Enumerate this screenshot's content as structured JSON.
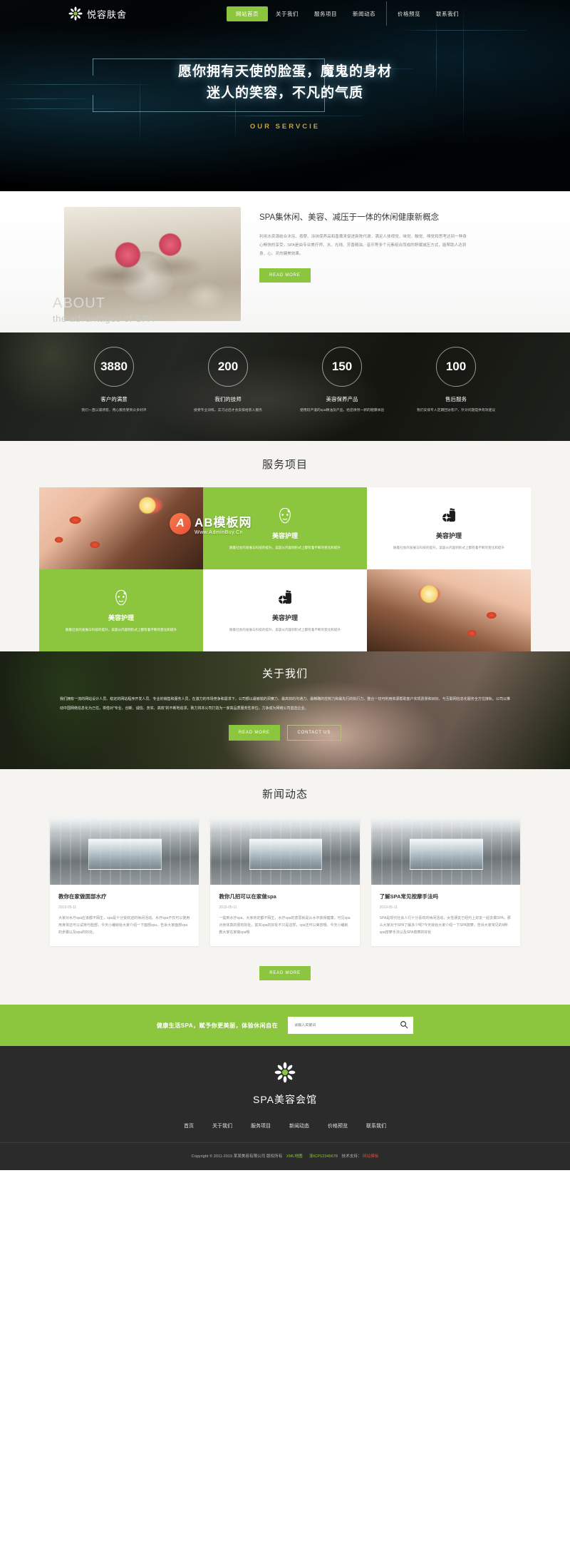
{
  "header": {
    "brand": "悦容肤舍",
    "logo_icon": "flower-icon",
    "nav": [
      {
        "label": "网站首页",
        "active": true
      },
      {
        "label": "关于我们",
        "active": false
      },
      {
        "label": "服务项目",
        "active": false
      },
      {
        "label": "新闻动态",
        "active": false
      },
      {
        "label": "价格预览",
        "active": false
      },
      {
        "label": "联系我们",
        "active": false
      }
    ]
  },
  "hero": {
    "line1": "愿你拥有天使的脸蛋，魔鬼的身材",
    "line2": "迷人的笑容，不凡的气质",
    "subtitle": "OUR SERVCIE"
  },
  "about": {
    "heading": "SPA集休闲、美容、减压于一体的休闲健康新概念",
    "paragraph": "利用水资源结合沐浴、按摩、涂抹保养品和香薰来促进新陈代谢，满足人体视觉、味觉、触觉、嗅觉和思考达到一种身心畅快的享受。SPA是由专业美疗师、水、光线、芳香精油、音乐等多个元素组合而成的舒缓减压方式，能帮助人达到身、心、灵的健美效果。",
    "button": "READ MORE",
    "watermark_big": "ABOUT",
    "watermark_small": "the advantages of SPA"
  },
  "stats": [
    {
      "number": "3880",
      "label": "客户的满意",
      "desc": "我们一直以诚待客，用心服务受到众多好评"
    },
    {
      "number": "200",
      "label": "我们的技师",
      "desc": "接受专业训练，实习过后才会安排给客人服务"
    },
    {
      "number": "150",
      "label": "美容保养产品",
      "desc": "使用较严谨的spa精油及产品，给您焕然一新的健康体验"
    },
    {
      "number": "100",
      "label": "售后服务",
      "desc": "我们安排专人定期回访客户，针对问题提供有效建议"
    }
  ],
  "services": {
    "title": "服务项目",
    "watermark": {
      "badge": "A",
      "main": "AB模板网",
      "sub": "Www.AdminBuy.Cn"
    },
    "cards": [
      {
        "type": "image",
        "style": "hand",
        "icon": ""
      },
      {
        "type": "green",
        "icon": "facial-mask-icon",
        "title": "美容护理",
        "desc": "随着社会的发展与科技的提升，美容从内容到形式上都有着不断的变化和提升"
      },
      {
        "type": "white",
        "icon": "lotion-bottle-icon",
        "title": "美容护理",
        "desc": "随着社会的发展与科技的提升，美容从内容到形式上都有着不断的变化和提升"
      },
      {
        "type": "green",
        "icon": "facial-mask-icon",
        "title": "美容护理",
        "desc": "随着社会的发展与科技的提升，美容从内容到形式上都有着不断的变化和提升"
      },
      {
        "type": "white",
        "icon": "lotion-bottle-icon",
        "title": "美容护理",
        "desc": "随着社会的发展与科技的提升，美容从内容到形式上都有着不断的变化和提升"
      },
      {
        "type": "image",
        "style": "flower",
        "icon": ""
      }
    ]
  },
  "aboutus": {
    "title": "关于我们",
    "paragraph": "我们拥有一流的网站设计人员、稳定的网站程序开发人员、专业的销售和服务人员，在激力的市场竞争和需求下，公司额以最敏锐的洞察力、最高效的沟通力、最精确的控制力和最先行的执行力、整合一切可利用资源帮助客户实现愿景和目标、与互联网信息化服务全方位接轨。公司以推动中国网络信息化为己任，将借对\"专业、创新、诚信、务实、高效\"的不断地追求，致力将本公司打造为一家高品质服务性单位，力争成为网络公司首选企业。",
    "btn_primary": "READ MORE",
    "btn_secondary": "CONTACT US"
  },
  "news": {
    "title": "新闻动态",
    "more_button": "READ MORE",
    "cards": [
      {
        "title": "教你在家做面部水疗",
        "date": "2019-05-11",
        "desc": "大家对水疗spa应该都不陌生，spa是十分受欢迎的休闲活动。水疗spa不仅可以使用用身体还可以试用与脸部，今天小编就给大家介绍一下面部spa，告诉大家面部spa的步骤以及spa的好处。"
      },
      {
        "title": "教你几招可以在家做spa",
        "date": "2019-05-11",
        "desc": "一提到水疗spa，大家肯定都不陌生，水疗spa的意思就是从水中获得健康，可见spa对身体真的很有好处，其实spa的好处不只是这样，spa还可以美容哦。今天小编就教大家在家做spa哦"
      },
      {
        "title": "了解SPA常见按摩手法吗",
        "date": "2019-05-11",
        "desc": "SPA是现代社会人们十分喜欢的休闲活动，女性朋友已经约上好友一起去做SPA，那么大家对于SPA了解多少呢?今天就给大家介绍一下SPA按摩，告诉大家常见的9种spa按摩手法以及SPA按摩的好处"
      }
    ]
  },
  "newsletter": {
    "slogan": "健康生活SPA，赋予你更美丽，体验休闲自在",
    "placeholder": "请输入关键词",
    "search_icon": "search-icon"
  },
  "footer": {
    "logo_icon": "flower-icon",
    "brand": "SPA美容会馆",
    "nav": [
      "首页",
      "关于我们",
      "服务项目",
      "新闻动态",
      "价格预览",
      "联系我们"
    ],
    "copyright_prefix": "Copyright © 2011-2019 某某美容有限公司 版权所有",
    "link_xml": "XML地图",
    "link_icp": "浙ICP12345678",
    "support_label": "技术支持：",
    "support_link": "网站模板"
  },
  "colors": {
    "accent_green": "#8cc63e",
    "footer_bg": "#2b2b2b",
    "section_bg": "#f5f4f0",
    "gold": "#c8a24a"
  }
}
